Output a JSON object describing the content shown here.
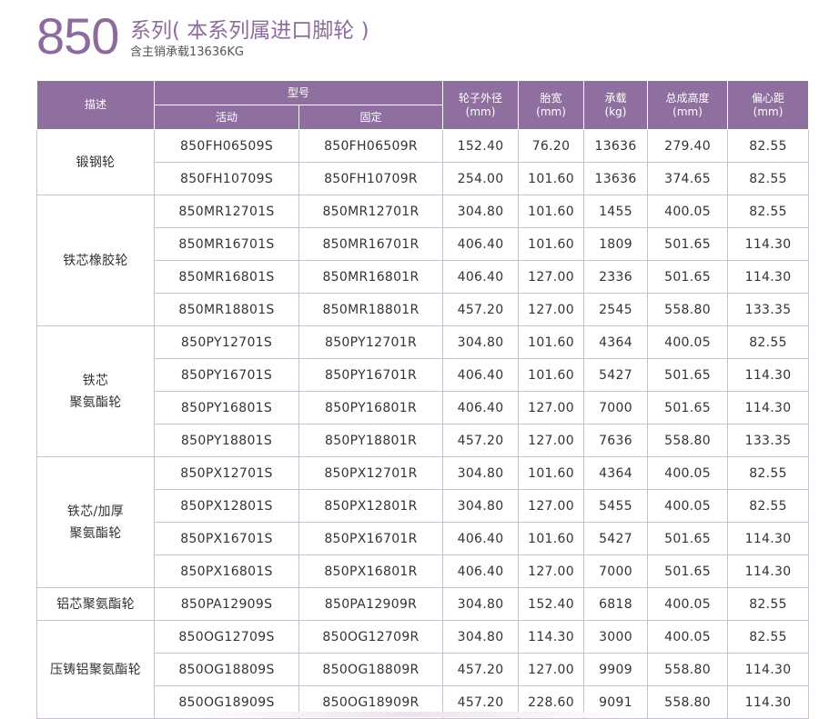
{
  "header": {
    "series_number": "850",
    "series_name": "系列( 本系列属进口脚轮 )",
    "note": "含主销承载13636KG"
  },
  "table": {
    "headers": {
      "desc": "描述",
      "model": "型号",
      "swivel": "活动",
      "rigid": "固定",
      "diameter": "轮子外径",
      "diameter_unit": "(mm)",
      "tread": "胎宽",
      "tread_unit": "(mm)",
      "load": "承载",
      "load_unit": "(kg)",
      "height": "总成高度",
      "height_unit": "(mm)",
      "offset": "偏心距",
      "offset_unit": "(mm)"
    },
    "groups": [
      {
        "desc_lines": [
          "锻钢轮"
        ],
        "rows": [
          [
            "850FH06509S",
            "850FH06509R",
            "152.40",
            "76.20",
            "13636",
            "279.40",
            "82.55"
          ],
          [
            "850FH10709S",
            "850FH10709R",
            "254.00",
            "101.60",
            "13636",
            "374.65",
            "82.55"
          ]
        ]
      },
      {
        "desc_lines": [
          "铁芯橡胶轮"
        ],
        "rows": [
          [
            "850MR12701S",
            "850MR12701R",
            "304.80",
            "101.60",
            "1455",
            "400.05",
            "82.55"
          ],
          [
            "850MR16701S",
            "850MR16701R",
            "406.40",
            "101.60",
            "1809",
            "501.65",
            "114.30"
          ],
          [
            "850MR16801S",
            "850MR16801R",
            "406.40",
            "127.00",
            "2336",
            "501.65",
            "114.30"
          ],
          [
            "850MR18801S",
            "850MR18801R",
            "457.20",
            "127.00",
            "2545",
            "558.80",
            "133.35"
          ]
        ]
      },
      {
        "desc_lines": [
          "铁芯",
          "聚氨酯轮"
        ],
        "rows": [
          [
            "850PY12701S",
            "850PY12701R",
            "304.80",
            "101.60",
            "4364",
            "400.05",
            "82.55"
          ],
          [
            "850PY16701S",
            "850PY16701R",
            "406.40",
            "101.60",
            "5427",
            "501.65",
            "114.30"
          ],
          [
            "850PY16801S",
            "850PY16801R",
            "406.40",
            "127.00",
            "7000",
            "501.65",
            "114.30"
          ],
          [
            "850PY18801S",
            "850PY18801R",
            "457.20",
            "127.00",
            "7636",
            "558.80",
            "133.35"
          ]
        ]
      },
      {
        "desc_lines": [
          "铁芯/加厚",
          "聚氨酯轮"
        ],
        "rows": [
          [
            "850PX12701S",
            "850PX12701R",
            "304.80",
            "101.60",
            "4364",
            "400.05",
            "82.55"
          ],
          [
            "850PX12801S",
            "850PX12801R",
            "304.80",
            "127.00",
            "5455",
            "400.05",
            "82.55"
          ],
          [
            "850PX16701S",
            "850PX16701R",
            "406.40",
            "101.60",
            "5427",
            "501.65",
            "114.30"
          ],
          [
            "850PX16801S",
            "850PX16801R",
            "406.40",
            "127.00",
            "7000",
            "501.65",
            "114.30"
          ]
        ]
      },
      {
        "desc_lines": [
          "铝芯聚氨酯轮"
        ],
        "rows": [
          [
            "850PA12909S",
            "850PA12909R",
            "304.80",
            "152.40",
            "6818",
            "400.05",
            "82.55"
          ]
        ]
      },
      {
        "desc_lines": [
          "压铸铝聚氨酯轮"
        ],
        "rows": [
          [
            "850OG12709S",
            "850OG12709R",
            "304.80",
            "114.30",
            "3000",
            "400.05",
            "82.55"
          ],
          [
            "850OG18809S",
            "850OG18809R",
            "457.20",
            "127.00",
            "9909",
            "558.80",
            "114.30"
          ],
          [
            "850OG18909S",
            "850OG18909R",
            "457.20",
            "228.60",
            "9091",
            "558.80",
            "114.30"
          ]
        ]
      }
    ]
  }
}
